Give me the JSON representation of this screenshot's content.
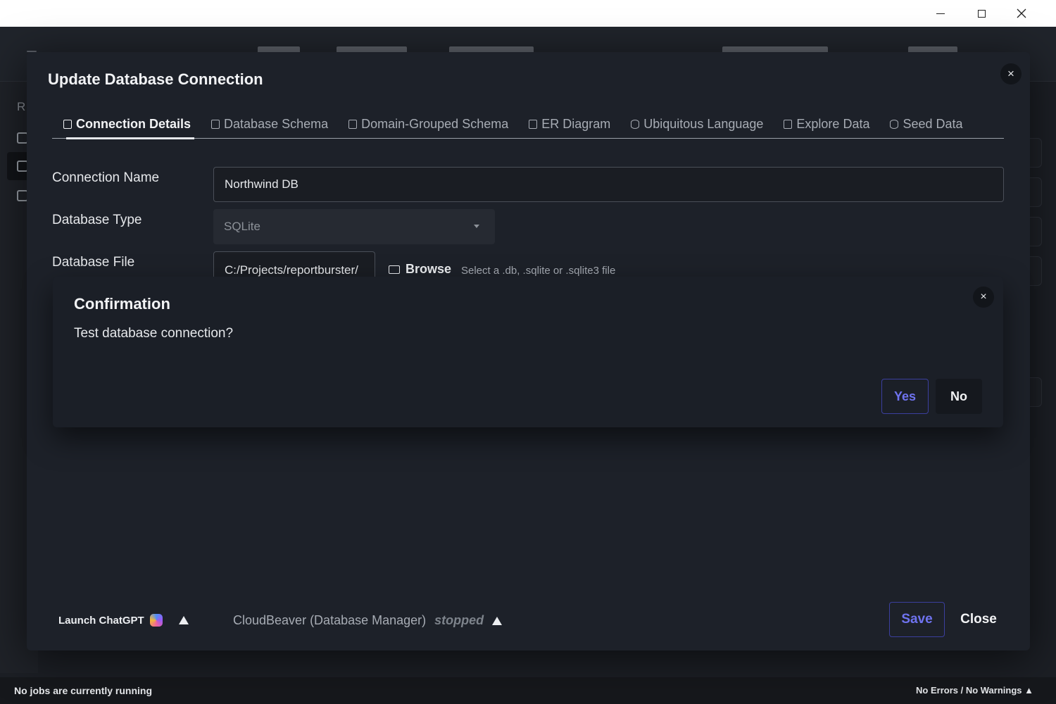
{
  "window": {
    "minimize_icon": "minimize-icon",
    "maximize_icon": "maximize-icon",
    "close_icon": "close-icon"
  },
  "background_app": {
    "rail_letter": "R"
  },
  "modal": {
    "title": "Update Database Connection",
    "close_glyph": "×",
    "tabs": [
      {
        "label": "Connection Details",
        "icon": "settings-icon",
        "active": true
      },
      {
        "label": "Database Schema",
        "icon": "book-icon",
        "active": false
      },
      {
        "label": "Domain-Grouped Schema",
        "icon": "group-icon",
        "active": false
      },
      {
        "label": "ER Diagram",
        "icon": "map-icon",
        "active": false
      },
      {
        "label": "Ubiquitous Language",
        "icon": "language-icon",
        "active": false
      },
      {
        "label": "Explore Data",
        "icon": "map-icon",
        "active": false
      },
      {
        "label": "Seed Data",
        "icon": "database-icon",
        "active": false
      }
    ],
    "form": {
      "connection_name_label": "Connection Name",
      "connection_name_value": "Northwind DB",
      "database_type_label": "Database Type",
      "database_type_value": "SQLite",
      "database_file_label": "Database File",
      "database_file_value": "C:/Projects/reportburster/",
      "browse_label": "Browse",
      "file_hint": "Select a .db, .sqlite or .sqlite3 file"
    },
    "footer": {
      "chatgpt_label": "Launch ChatGPT",
      "cloudbeaver_label": "CloudBeaver (Database Manager)",
      "cloudbeaver_status": "stopped",
      "save_label": "Save",
      "close_label": "Close"
    }
  },
  "confirmation": {
    "title": "Confirmation",
    "message": "Test database connection?",
    "close_glyph": "×",
    "yes_label": "Yes",
    "no_label": "No"
  },
  "statusbar": {
    "left": "No jobs are currently running",
    "right": "No Errors / No Warnings ▲"
  },
  "colors": {
    "accent": "#6f73f0",
    "brand_accent": "#b46c48",
    "surface": "#1d2129"
  }
}
